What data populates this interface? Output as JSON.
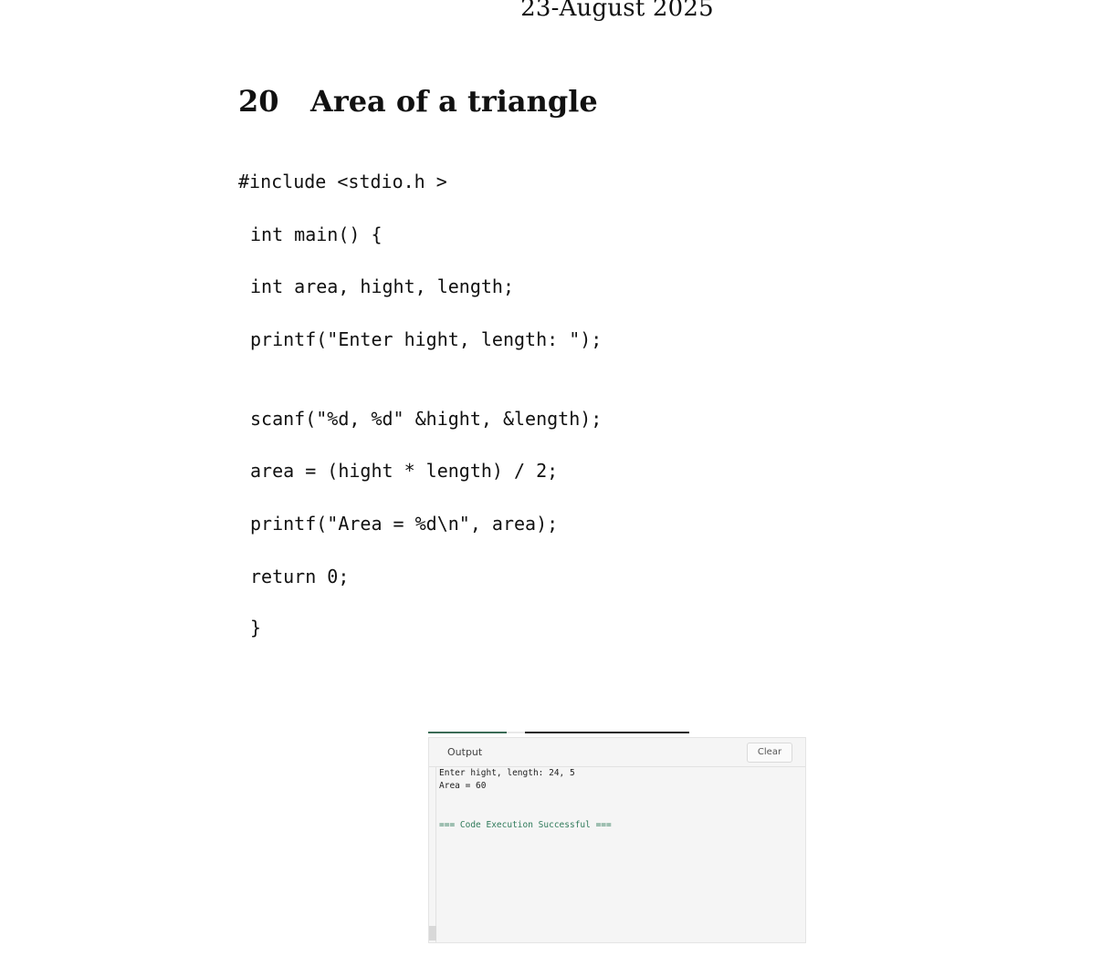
{
  "header": {
    "date": "23-August 2025"
  },
  "section": {
    "number": "20",
    "title": "Area of a triangle"
  },
  "code": {
    "lines": [
      "#include <stdio.h >",
      "int main() {",
      "int area, hight, length;",
      "printf(\"Enter hight, length: \");",
      "scanf(\"%d, %d\" &hight, &length);",
      "area = (hight * length) / 2;",
      "printf(\"Area = %d\\n\", area);",
      "return 0;",
      "}"
    ]
  },
  "output_panel": {
    "title": "Output",
    "clear_label": "Clear",
    "lines": [
      "Enter hight, length: 24, 5",
      "Area = 60"
    ],
    "status": "=== Code Execution Successful ==="
  }
}
